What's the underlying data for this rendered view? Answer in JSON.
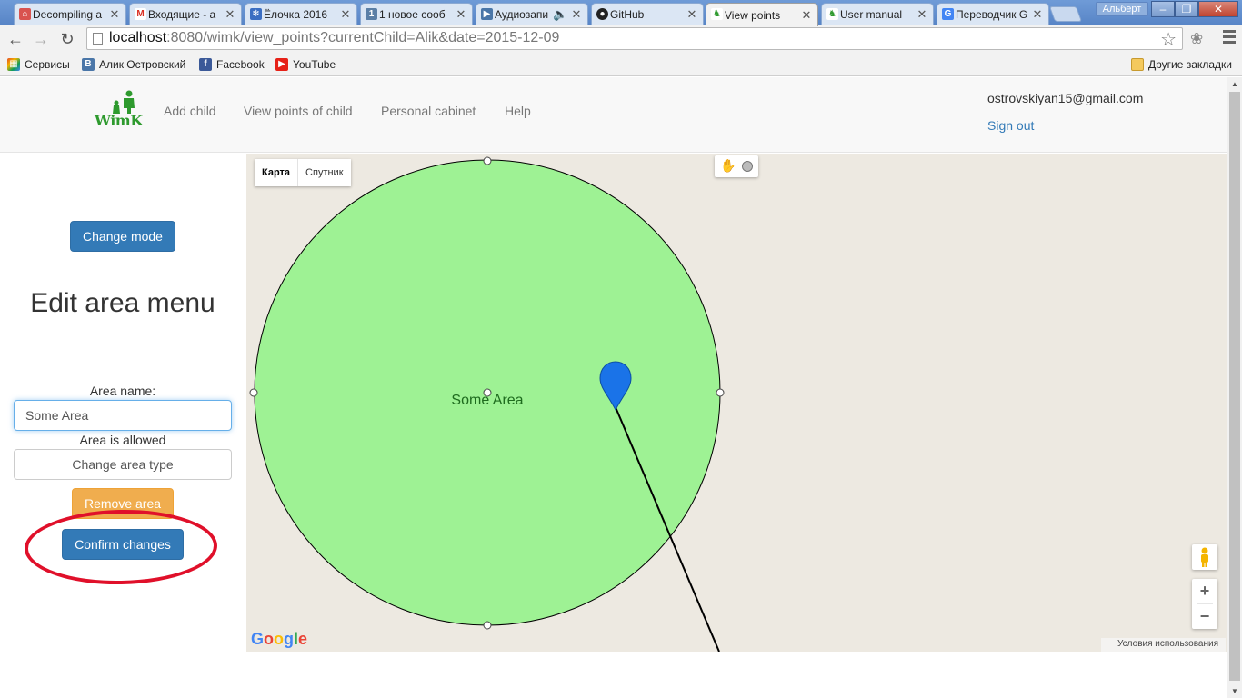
{
  "browser": {
    "tabs": [
      {
        "title": "Decompiling a",
        "icon": "decompile-icon",
        "color": "#d9534f"
      },
      {
        "title": "Входящие - a",
        "icon": "gmail-icon",
        "color": "#d93025"
      },
      {
        "title": "Ёлочка 2016",
        "icon": "snowflake-icon",
        "color": "#3b6ec2"
      },
      {
        "title": "1 новое сооб",
        "icon": "vk-notification-icon",
        "color": "#5b7fa6"
      },
      {
        "title": "Аудиозапи",
        "icon": "audio-play-icon",
        "color": "#4a76a8"
      },
      {
        "title": "GitHub",
        "icon": "github-icon",
        "color": "#222222"
      },
      {
        "title": "View points",
        "icon": "wimk-favicon",
        "color": "#2e9a2e"
      },
      {
        "title": "User manual",
        "icon": "wimk-favicon",
        "color": "#2e9a2e"
      },
      {
        "title": "Переводчик G",
        "icon": "translate-icon",
        "color": "#4285f4"
      }
    ],
    "profile_name": "Альберт",
    "url_host": "localhost",
    "url_rest": ":8080/wimk/view_points?currentChild=Alik&date=2015-12-09",
    "bookmarks": [
      {
        "label": "Сервисы",
        "icon": "apps-icon",
        "color": "#e44d26"
      },
      {
        "label": "Алик Островский",
        "icon": "vk-icon",
        "color": "#4a76a8"
      },
      {
        "label": "Facebook",
        "icon": "facebook-icon",
        "color": "#3b5998"
      },
      {
        "label": "YouTube",
        "icon": "youtube-icon",
        "color": "#e62117"
      }
    ],
    "other_bookmarks": "Другие закладки"
  },
  "header": {
    "logo_text": "WimK",
    "nav": [
      "Add child",
      "View points of child",
      "Personal cabinet",
      "Help"
    ],
    "user_email": "ostrovskiyan15@gmail.com",
    "sign_out": "Sign out"
  },
  "sidebar": {
    "change_mode": "Change mode",
    "title": "Edit area menu",
    "area_name_label": "Area name:",
    "area_name_value": "Some Area",
    "area_status": "Area is allowed",
    "change_area_type": "Change area type",
    "remove_area": "Remove area",
    "confirm_changes": "Confirm changes"
  },
  "map": {
    "type_map": "Карта",
    "type_satellite": "Спутник",
    "area_label": "Some Area",
    "area_fill": "#9ef294",
    "marker_color": "#1a73e8",
    "google_logo": "Google",
    "terms": "Условия использования"
  },
  "annotation_color": "#e0102a"
}
